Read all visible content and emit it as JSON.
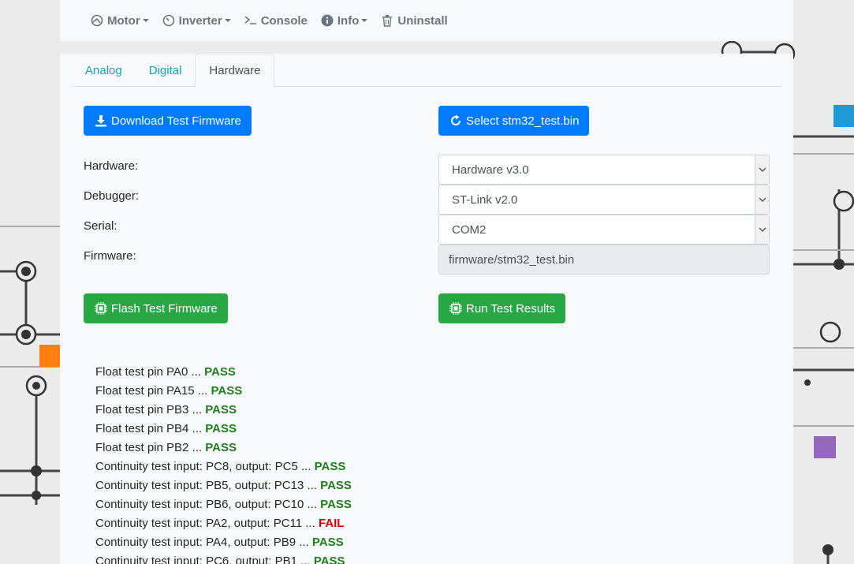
{
  "navbar": {
    "items": [
      {
        "label": "Motor",
        "icon": "gauge-icon",
        "dropdown": true
      },
      {
        "label": "Inverter",
        "icon": "dial-icon",
        "dropdown": true
      },
      {
        "label": "Console",
        "icon": "terminal-icon",
        "dropdown": false
      },
      {
        "label": "Info",
        "icon": "info-icon",
        "dropdown": true
      },
      {
        "label": "Uninstall",
        "icon": "trash-icon",
        "dropdown": false
      }
    ]
  },
  "tabs": [
    {
      "label": "Analog",
      "active": false
    },
    {
      "label": "Digital",
      "active": false
    },
    {
      "label": "Hardware",
      "active": true
    }
  ],
  "buttons": {
    "download_firmware": "Download Test Firmware",
    "select_bin": "Select stm32_test.bin",
    "flash_firmware": "Flash Test Firmware",
    "run_results": "Run Test Results"
  },
  "form": {
    "hardware_label": "Hardware:",
    "hardware_value": "Hardware v3.0",
    "debugger_label": "Debugger:",
    "debugger_value": "ST-Link v2.0",
    "serial_label": "Serial:",
    "serial_value": "COM2",
    "firmware_label": "Firmware:",
    "firmware_value": "firmware/stm32_test.bin"
  },
  "results": [
    {
      "text": "Float test pin PA0 ... ",
      "status": "PASS"
    },
    {
      "text": "Float test pin PA15 ... ",
      "status": "PASS"
    },
    {
      "text": "Float test pin PB3 ... ",
      "status": "PASS"
    },
    {
      "text": "Float test pin PB4 ... ",
      "status": "PASS"
    },
    {
      "text": "Float test pin PB2 ... ",
      "status": "PASS"
    },
    {
      "text": "Continuity test input: PC8, output: PC5 ... ",
      "status": "PASS"
    },
    {
      "text": "Continuity test input: PB5, output: PC13 ... ",
      "status": "PASS"
    },
    {
      "text": "Continuity test input: PB6, output: PC10 ... ",
      "status": "PASS"
    },
    {
      "text": "Continuity test input: PA2, output: PC11 ... ",
      "status": "FAIL"
    },
    {
      "text": "Continuity test input: PA4, output: PB9 ... ",
      "status": "PASS"
    },
    {
      "text": "Continuity test input: PC6, output: PB1 ... ",
      "status": "PASS"
    }
  ],
  "colors": {
    "primary": "#007bff",
    "success": "#28a745",
    "pass": "#1e7e1e",
    "fail": "#e00000",
    "tab_link": "#17a2b8"
  }
}
